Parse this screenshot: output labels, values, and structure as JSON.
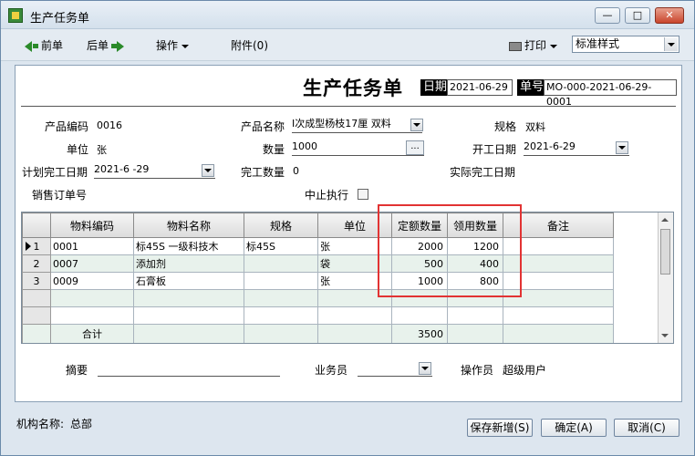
{
  "window": {
    "title": "生产任务单",
    "buttons": {
      "minimize": "—",
      "maximize": "□",
      "close": "✕"
    }
  },
  "toolbar": {
    "prev": "前单",
    "next": "后单",
    "operate": "操作",
    "attachment": "附件(0)",
    "print": "打印",
    "style_value": "标准样式"
  },
  "form": {
    "title": "生产任务单",
    "date_label": "日期",
    "date_value": "2021-06-29",
    "no_label": "单号",
    "no_value": "MO-000-2021-06-29-0001",
    "fields": {
      "product_code_label": "产品编码",
      "product_code": "0016",
      "product_name_label": "产品名称",
      "product_name": "I次成型杨枝17厘  双料",
      "spec_label": "规格",
      "spec": "双料",
      "unit_label": "单位",
      "unit": "张",
      "qty_label": "数量",
      "qty": "1000",
      "start_date_label": "开工日期",
      "start_date": "2021-6-29",
      "plan_finish_label": "计划完工日期",
      "plan_finish": "2021-6 -29",
      "done_qty_label": "完工数量",
      "done_qty": "0",
      "actual_finish_label": "实际完工日期",
      "actual_finish": "",
      "sales_order_label": "销售订单号",
      "sales_order": "",
      "stop_label": "中止执行"
    }
  },
  "grid": {
    "columns": [
      "物料编码",
      "物料名称",
      "规格",
      "单位",
      "定额数量",
      "领用数量",
      "备注"
    ],
    "rows": [
      {
        "rn": "1",
        "code": "0001",
        "name": "标45S 一级科技木",
        "spec": "标45S",
        "unit": "张",
        "quota": "2000",
        "used": "1200",
        "note": ""
      },
      {
        "rn": "2",
        "code": "0007",
        "name": "添加剂",
        "spec": "",
        "unit": "袋",
        "quota": "500",
        "used": "400",
        "note": ""
      },
      {
        "rn": "3",
        "code": "0009",
        "name": "石膏板",
        "spec": "",
        "unit": "张",
        "quota": "1000",
        "used": "800",
        "note": ""
      }
    ],
    "total_label": "合计",
    "total_quota": "3500"
  },
  "bottom": {
    "summary_label": "摘要",
    "salesman_label": "业务员",
    "operator_label": "操作员",
    "operator_value": "超级用户"
  },
  "footer": {
    "org_label": "机构名称:",
    "org_value": "总部",
    "save_new": "保存新增(S)",
    "ok": "确定(A)",
    "cancel": "取消(C)"
  }
}
